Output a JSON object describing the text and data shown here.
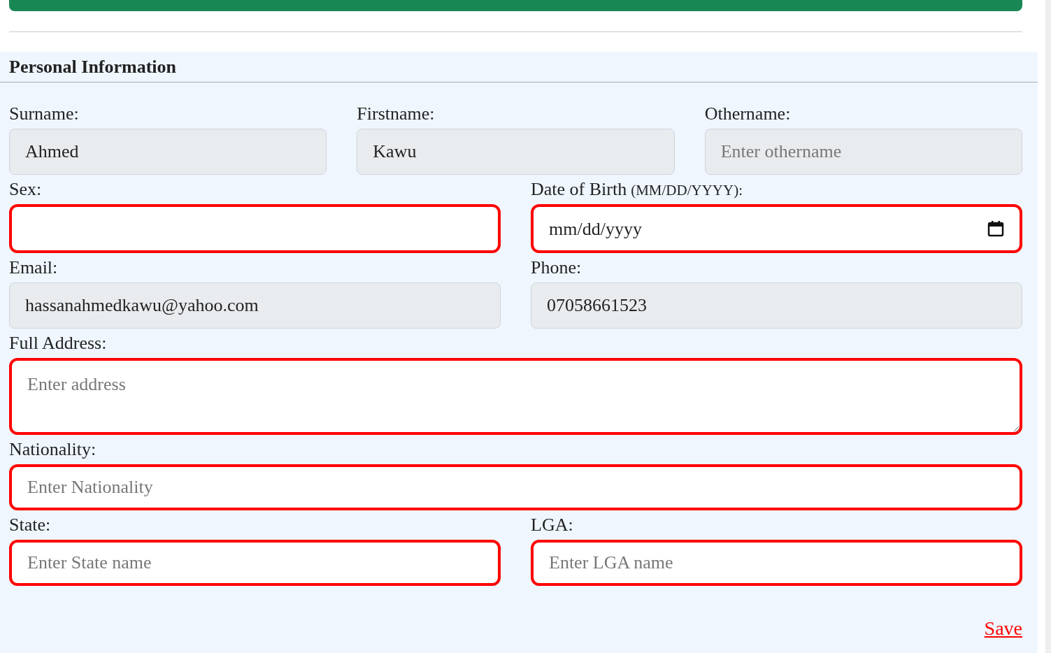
{
  "section": {
    "title": "Personal Information"
  },
  "rows": [
    {
      "fields": [
        {
          "kind": "text",
          "label": "Surname:",
          "value": "Ahmed",
          "disabled": true,
          "highlighted": false
        },
        {
          "kind": "text",
          "label": "Firstname:",
          "value": "Kawu",
          "disabled": true,
          "highlighted": false
        },
        {
          "kind": "text",
          "label": "Othername:",
          "placeholder": "Enter othername",
          "disabled": true,
          "highlighted": false
        }
      ]
    },
    {
      "fields": [
        {
          "kind": "select",
          "label": "Sex:",
          "disabled": false,
          "highlighted": true
        },
        {
          "kind": "date",
          "label": "Date of Birth",
          "label_note": "(MM/DD/YYYY):",
          "placeholder": "mm/dd/yyyy",
          "disabled": false,
          "highlighted": true
        }
      ]
    },
    {
      "fields": [
        {
          "kind": "text",
          "label": "Email:",
          "value": "hassanahmedkawu@yahoo.com",
          "disabled": true,
          "highlighted": false
        },
        {
          "kind": "text",
          "label": "Phone:",
          "value": "07058661523",
          "disabled": true,
          "highlighted": false
        }
      ]
    },
    {
      "fields": [
        {
          "kind": "textarea",
          "label": "Full Address:",
          "placeholder": "Enter address",
          "disabled": false,
          "highlighted": true
        }
      ]
    },
    {
      "fields": [
        {
          "kind": "text",
          "label": "Nationality:",
          "placeholder": "Enter Nationality",
          "disabled": false,
          "highlighted": true
        }
      ]
    },
    {
      "fields": [
        {
          "kind": "text",
          "label": "State:",
          "placeholder": "Enter State name",
          "disabled": false,
          "highlighted": true
        },
        {
          "kind": "text",
          "label": "LGA:",
          "placeholder": "Enter LGA name",
          "disabled": false,
          "highlighted": true
        }
      ]
    }
  ],
  "save": {
    "label": "Save"
  }
}
